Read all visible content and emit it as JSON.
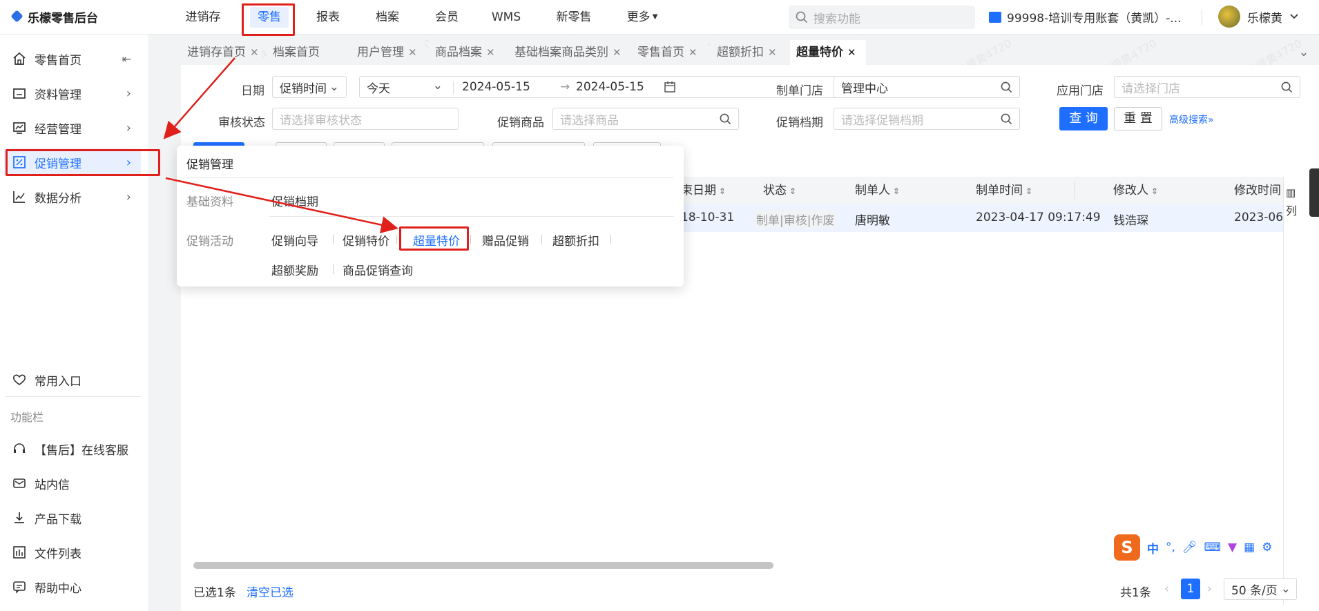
{
  "app": {
    "title": "乐檬零售后台"
  },
  "topnav": [
    "进销存",
    "零售",
    "报表",
    "档案",
    "会员",
    "WMS",
    "新零售",
    "更多"
  ],
  "search": {
    "placeholder": "搜索功能"
  },
  "account": {
    "label": "99998-培训专用账套（黄凯）-..."
  },
  "user": {
    "name": "乐檬黄"
  },
  "sidebar": {
    "items": [
      {
        "label": "零售首页",
        "icon": "home-icon"
      },
      {
        "label": "资料管理",
        "icon": "folder-icon"
      },
      {
        "label": "经营管理",
        "icon": "chart-line-icon"
      },
      {
        "label": "促销管理",
        "icon": "promotion-icon"
      },
      {
        "label": "数据分析",
        "icon": "analytics-icon"
      }
    ],
    "favorites": "常用入口",
    "section_title": "功能栏",
    "tools": [
      {
        "label": "【售后】在线客服",
        "icon": "headset-icon"
      },
      {
        "label": "站内信",
        "icon": "mail-icon"
      },
      {
        "label": "产品下载",
        "icon": "download-icon"
      },
      {
        "label": "文件列表",
        "icon": "file-list-icon"
      },
      {
        "label": "帮助中心",
        "icon": "help-icon"
      }
    ]
  },
  "tabs": [
    "进销存首页",
    "档案首页",
    "用户管理",
    "商品档案",
    "基础档案商品类别",
    "零售首页",
    "超额折扣",
    "超量特价"
  ],
  "filters": {
    "date_label": "日期",
    "date_type": "促销时间",
    "date_range": "今天",
    "date_start": "2024-05-15",
    "date_end": "2024-05-15",
    "store_label": "制单门店",
    "store_value": "管理中心",
    "apply_store_label": "应用门店",
    "apply_store_placeholder": "请选择门店",
    "audit_label": "审核状态",
    "audit_placeholder": "请选择审核状态",
    "product_label": "促销商品",
    "product_placeholder": "请选择商品",
    "period_label": "促销档期",
    "period_placeholder": "请选择促销档期",
    "query": "查 询",
    "reset": "重 置",
    "advanced": "高级搜索"
  },
  "table": {
    "headers": [
      "束日期",
      "状态",
      "制单人",
      "制单时间",
      "修改人",
      "修改时间"
    ],
    "columns_btn": "列",
    "row": {
      "end_date": "18-10-31",
      "status": "制单|审核|作废",
      "creator": "唐明敏",
      "created_at": "2023-04-17 09:17:49",
      "modifier": "钱浩琛",
      "modified_at": "2023-06"
    }
  },
  "popup": {
    "title": "促销管理",
    "groups": [
      {
        "label": "基础资料",
        "links": [
          "促销档期"
        ]
      },
      {
        "label": "促销活动",
        "links": [
          "促销向导",
          "促销特价",
          "超量特价",
          "赠品促销",
          "超额折扣",
          "超额奖励",
          "商品促销查询"
        ]
      }
    ]
  },
  "footer": {
    "selected": "已选1条",
    "clear": "清空已选",
    "total": "共1条",
    "page": "1",
    "page_size": "50 条/页"
  },
  "ime": {
    "label": "中"
  },
  "watermark": "乐檬黄4720",
  "colors": {
    "primary": "#1e6fff",
    "annotation": "#e0201b"
  }
}
